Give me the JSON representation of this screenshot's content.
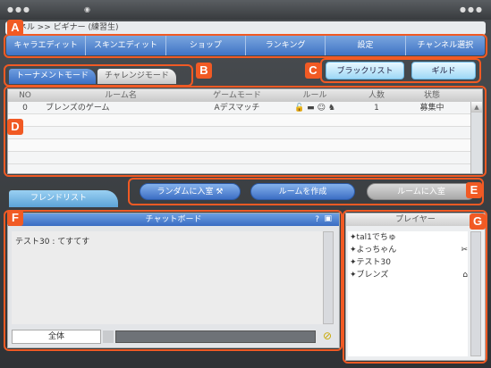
{
  "header": {
    "breadcrumb": "ンネル >>  ビギナー (練習生)"
  },
  "menu": [
    "キャラエディット",
    "スキンエディット",
    "ショップ",
    "ランキング",
    "設定",
    "チャンネル選択"
  ],
  "tabs": {
    "tournament": "トーナメントモード",
    "challenge": "チャレンジモード"
  },
  "right_buttons": {
    "blacklist": "ブラックリスト",
    "guild": "ギルド"
  },
  "room_table": {
    "headers": [
      "NO",
      "ルーム名",
      "ゲームモード",
      "ルール",
      "人数",
      "状態"
    ],
    "rows": [
      {
        "no": "0",
        "name": "ブレンズのゲーム",
        "mode": "Aデスマッチ",
        "players": "1",
        "status": "募集中"
      }
    ]
  },
  "actions": {
    "random": "ランダムに入室",
    "create": "ルームを作成",
    "enter": "ルームに入室"
  },
  "friend_tab": "フレンドリスト",
  "chat": {
    "title": "チャットボード",
    "messages": [
      "テスト30 : てすてす"
    ],
    "scope": "全体"
  },
  "players": {
    "title": "プレイヤー",
    "list": [
      "tal1でちゅ",
      "よっちゃん",
      "テスト30",
      "ブレンズ"
    ]
  },
  "labels": [
    "A",
    "B",
    "C",
    "D",
    "E",
    "F",
    "G"
  ],
  "colors": {
    "accent": "#f15a24",
    "menu_blue": "#3f73c4"
  }
}
